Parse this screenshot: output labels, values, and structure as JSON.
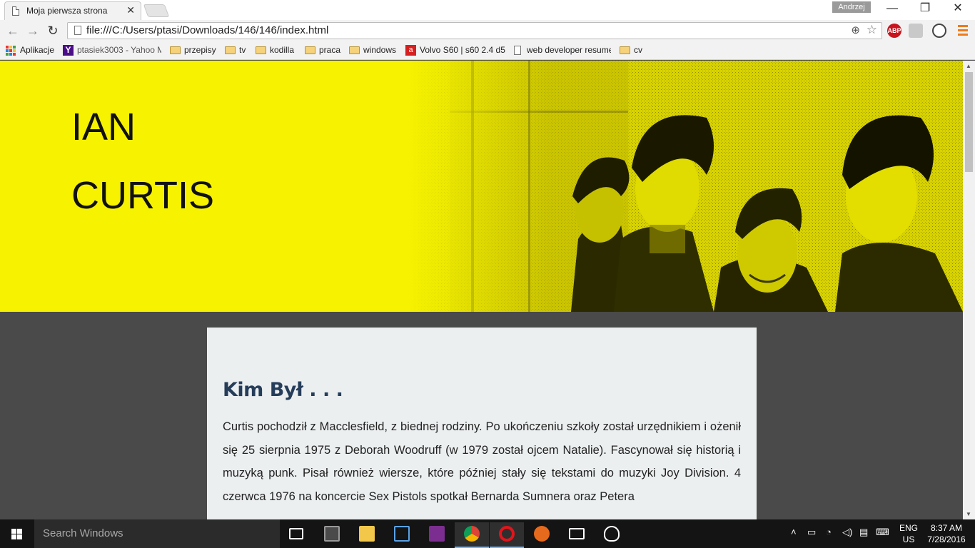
{
  "browser": {
    "tab_title": "Moja pierwsza strona",
    "tab_close": "✕",
    "user_name": "Andrzej",
    "window_controls": {
      "minimize": "—",
      "maximize": "❐",
      "close": "✕"
    },
    "url": "file:///C:/Users/ptasi/Downloads/146/146/index.html",
    "extensions": {
      "abp": "ABP"
    }
  },
  "bookmarks": [
    {
      "label": "Aplikacje",
      "icon": "apps-icon"
    },
    {
      "label": "ptasiek3003 - Yahoo M",
      "icon": "yahoo-icon"
    },
    {
      "label": "przepisy",
      "icon": "folder-icon"
    },
    {
      "label": "tv",
      "icon": "folder-icon"
    },
    {
      "label": "kodilla",
      "icon": "folder-icon"
    },
    {
      "label": "praca",
      "icon": "folder-icon"
    },
    {
      "label": "windows",
      "icon": "folder-icon"
    },
    {
      "label": "Volvo S60 | s60 2.4 d5",
      "icon": "page-icon"
    },
    {
      "label": "web developer resume",
      "icon": "page-icon"
    },
    {
      "label": "cv",
      "icon": "folder-icon"
    }
  ],
  "hero": {
    "first_name": "IAN",
    "last_name": "CURTIS",
    "background_color": "#f6f200"
  },
  "content": {
    "heading": "Kim Był . . .",
    "paragraph": "Curtis pochodził z Macclesfield, z biednej rodziny. Po ukończeniu szkoły został urzędnikiem i ożenił się 25 sierpnia 1975 z Deborah Woodruff (w 1979 został ojcem Natalie). Fascynował się historią i muzyką punk. Pisał również wiersze, które później stały się tekstami do muzyki Joy Division. 4 czerwca 1976 na koncercie Sex Pistols spotkał Bernarda Sumnera oraz Petera"
  },
  "taskbar": {
    "search_placeholder": "Search Windows",
    "language": {
      "line1": "ENG",
      "line2": "US"
    },
    "time": "8:37 AM",
    "date": "7/28/2016"
  }
}
